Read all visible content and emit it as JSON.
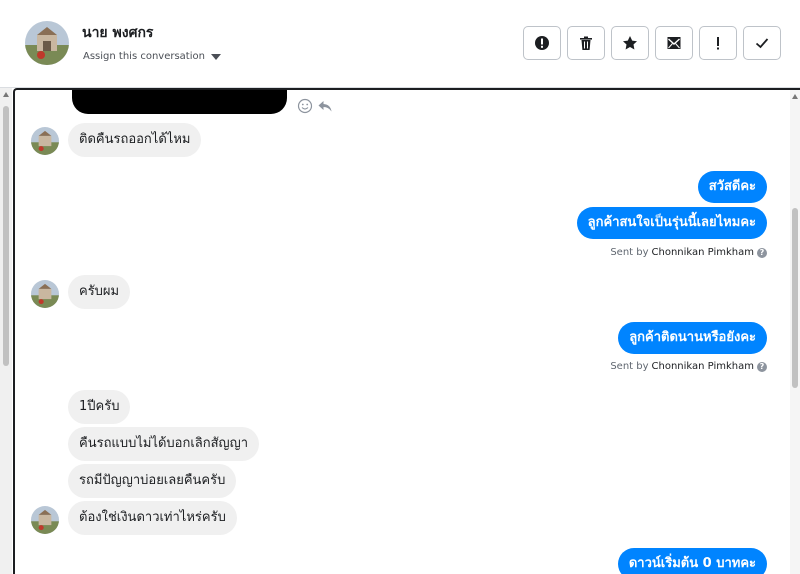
{
  "header": {
    "contact_name": "นาย พงศกร",
    "assign_label": "Assign this conversation",
    "toolbar": [
      {
        "name": "alert-icon-button",
        "icon": "alert-circle-icon"
      },
      {
        "name": "delete-button",
        "icon": "trash-icon"
      },
      {
        "name": "star-button",
        "icon": "star-icon"
      },
      {
        "name": "mark-unread-button",
        "icon": "envelope-icon"
      },
      {
        "name": "important-button",
        "icon": "exclamation-icon"
      },
      {
        "name": "done-button",
        "icon": "check-icon"
      }
    ]
  },
  "messages": {
    "in1": "ติดคืนรถออกได้ไหม",
    "out1": "สวัสดีคะ",
    "out2": "ลูกค้าสนใจเป็นรุ่นนี้เลยไหมคะ",
    "in2": "ครับผม",
    "out3": "ลูกค้าติดนานหรือยังคะ",
    "in3": "1ปีครับ",
    "in4": "คืนรถแบบไม่ได้บอกเลิกสัญญา",
    "in5": "รถมีปัญญาบ่อยเลยคืนครับ",
    "in6": "ต้องใช่เงินดาวเท่าไหร่ครับ",
    "out4": "ดาวน์เริ่มต้น 0 บาทคะ"
  },
  "sent_by": {
    "prefix": "Sent by",
    "agent": "Chonnikan Pimkham"
  },
  "colors": {
    "accent": "#0084ff",
    "incoming_bubble": "#f0f0f0"
  }
}
